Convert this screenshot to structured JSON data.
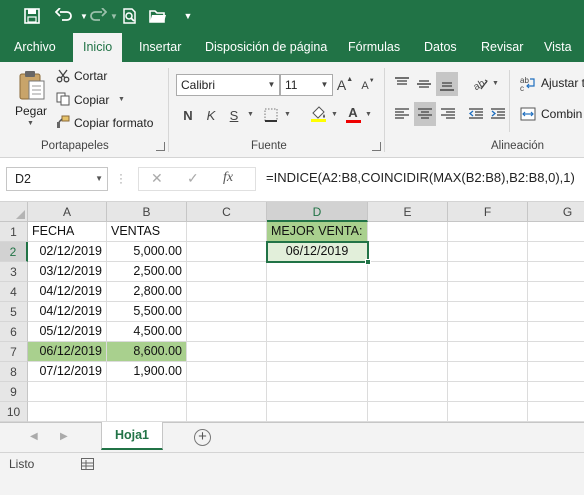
{
  "quick_access": {
    "icons": [
      "save-icon",
      "undo-icon",
      "redo-icon",
      "print-preview-icon",
      "open-folder-icon",
      "customize-icon"
    ]
  },
  "tabs": [
    {
      "label": "Archivo"
    },
    {
      "label": "Inicio"
    },
    {
      "label": "Insertar"
    },
    {
      "label": "Disposición de página"
    },
    {
      "label": "Fórmulas"
    },
    {
      "label": "Datos"
    },
    {
      "label": "Revisar"
    },
    {
      "label": "Vista"
    }
  ],
  "ribbon": {
    "clipboard": {
      "paste": "Pegar",
      "cut": "Cortar",
      "copy": "Copiar",
      "format_painter": "Copiar formato",
      "label": "Portapapeles"
    },
    "font": {
      "name": "Calibri",
      "size": "11",
      "bold": "N",
      "italic": "K",
      "underline": "S",
      "grow": "A",
      "shrink": "A",
      "font_color_letter": "A",
      "label": "Fuente"
    },
    "alignment": {
      "wrap_text": "Ajustar t",
      "merge": "Combin",
      "label": "Alineación"
    }
  },
  "formula_bar": {
    "name_box": "D2",
    "fx": "fx",
    "formula": "=INDICE(A2:B8,COINCIDIR(MAX(B2:B8),B2:B8,0),1)"
  },
  "sheet": {
    "columns": [
      "A",
      "B",
      "C",
      "D",
      "E",
      "F",
      "G"
    ],
    "rows": [
      "1",
      "2",
      "3",
      "4",
      "5",
      "6",
      "7",
      "8",
      "9",
      "10"
    ],
    "active_cell": "D2",
    "headers": {
      "fecha": "FECHA",
      "ventas": "VENTAS"
    },
    "data": [
      {
        "fecha": "02/12/2019",
        "ventas": "5,000.00"
      },
      {
        "fecha": "03/12/2019",
        "ventas": "2,500.00"
      },
      {
        "fecha": "04/12/2019",
        "ventas": "2,800.00"
      },
      {
        "fecha": "04/12/2019",
        "ventas": "5,500.00"
      },
      {
        "fecha": "05/12/2019",
        "ventas": "4,500.00"
      },
      {
        "fecha": "06/12/2019",
        "ventas": "8,600.00"
      },
      {
        "fecha": "07/12/2019",
        "ventas": "1,900.00"
      }
    ],
    "highlight_row": 7,
    "result_label": "MEJOR VENTA:",
    "result_value": "06/12/2019"
  },
  "sheet_tabs": {
    "active": "Hoja1"
  },
  "status_bar": {
    "text": "Listo"
  },
  "colors": {
    "excel_green": "#217346",
    "highlight_green": "#a9d08e",
    "result_green": "#e2efda"
  }
}
